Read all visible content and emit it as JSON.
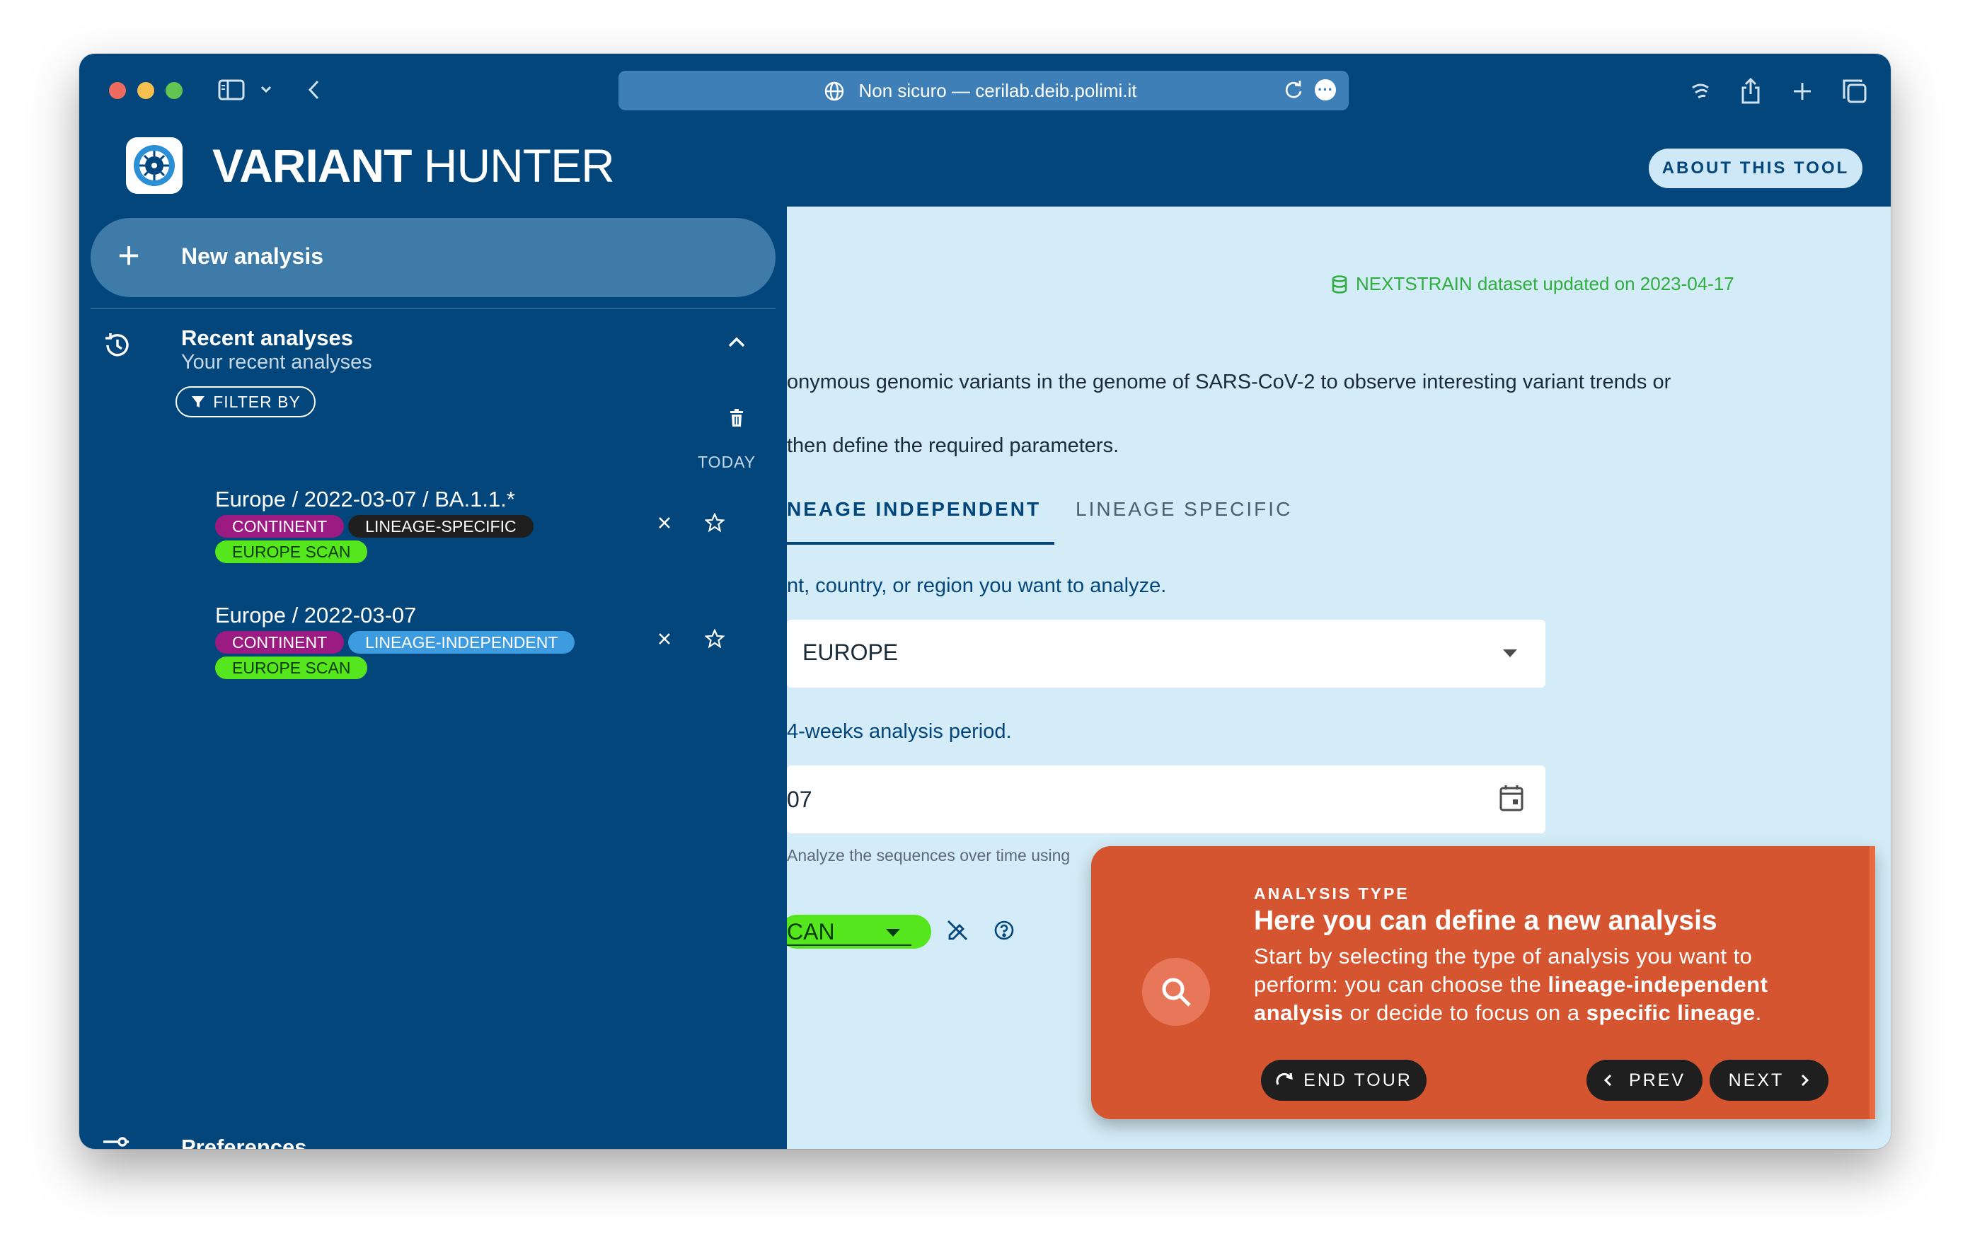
{
  "browser": {
    "url_display": "Non sicuro — cerilab.deib.polimi.it",
    "traffic_lights": [
      "#ed6a5e",
      "#f5bf4f",
      "#61c554"
    ]
  },
  "app": {
    "title_bold": "VARIANT",
    "title_light": "HUNTER",
    "about_button": "ABOUT THIS TOOL",
    "colors": {
      "primary": "#03467b",
      "background": "#d4ecf7",
      "accent": "#d4552f"
    }
  },
  "sidebar": {
    "new_analysis": "New analysis",
    "recent_title": "Recent analyses",
    "recent_subtitle": "Your recent analyses",
    "filter_button": "FILTER BY",
    "group_label": "TODAY",
    "analyses": [
      {
        "title": "Europe / 2022-03-07 / BA.1.1.*",
        "tags": [
          "CONTINENT",
          "LINEAGE-SPECIFIC",
          "EUROPE SCAN"
        ]
      },
      {
        "title": "Europe / 2022-03-07",
        "tags": [
          "CONTINENT",
          "LINEAGE-INDEPENDENT",
          "EUROPE SCAN"
        ]
      }
    ],
    "preferences": "Preferences"
  },
  "main": {
    "dataset_notice": "NEXTSTRAIN dataset updated on 2023-04-17",
    "description_line1": "onymous genomic variants in the genome of SARS-CoV-2 to observe interesting variant trends or",
    "description_line2": "then define the required parameters.",
    "tabs": [
      {
        "label": "NEAGE INDEPENDENT",
        "active": true
      },
      {
        "label": "LINEAGE SPECIFIC",
        "active": false
      }
    ],
    "region_label": "nt, country, or region you want to analyze.",
    "region_value": "EUROPE",
    "period_label": "4-weeks analysis period.",
    "date_value": "07",
    "helper_text": "Analyze the sequences over time using",
    "scan_value": "CAN"
  },
  "tour": {
    "overline": "ANALYSIS TYPE",
    "headline": "Here you can define a new analysis",
    "body_part1": "Start by selecting the type of analysis you want to perform: you can choose the ",
    "body_bold1": "lineage-independent analysis",
    "body_part2": " or decide to focus on a ",
    "body_bold2": "specific lineage",
    "body_part3": ".",
    "end_tour": "END TOUR",
    "prev": "PREV",
    "next": "NEXT"
  }
}
